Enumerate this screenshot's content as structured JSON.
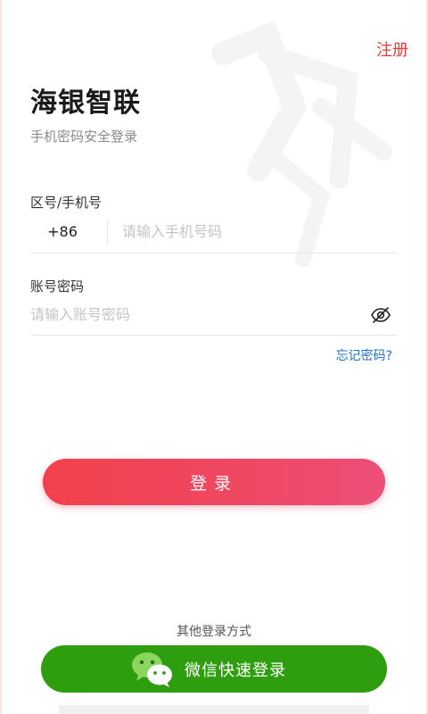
{
  "header": {
    "register_label": "注册"
  },
  "app": {
    "title": "海银智联",
    "subtitle": "手机密码安全登录"
  },
  "phone": {
    "label": "区号/手机号",
    "country_code": "+86",
    "value": "",
    "placeholder": "请输入手机号码"
  },
  "password": {
    "label": "账号密码",
    "value": "",
    "placeholder": "请输入账号密码",
    "visibility_icon": "eye-off-icon"
  },
  "forgot_password_label": "忘记密码?",
  "login_button_label": "登录",
  "other_methods_label": "其他登录方式",
  "wechat": {
    "button_label": "微信快速登录",
    "icon": "wechat-icon"
  },
  "colors": {
    "accent_red": "#e53935",
    "login_gradient_start": "#f2414b",
    "login_gradient_end": "#ec4f78",
    "link_blue": "#1e73c8",
    "wechat_green": "#2e9e0f"
  }
}
